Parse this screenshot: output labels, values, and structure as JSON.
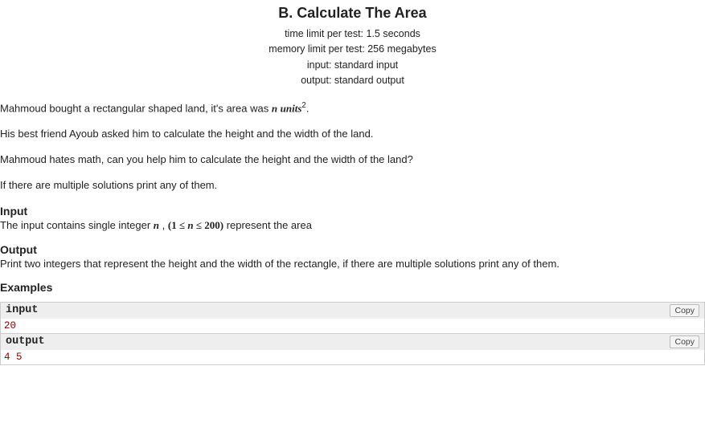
{
  "header": {
    "title": "B. Calculate The Area",
    "time_label": "time limit per test",
    "time_value": "1.5 seconds",
    "memory_label": "memory limit per test",
    "memory_value": "256 megabytes",
    "input_label": "input",
    "input_value": "standard input",
    "output_label": "output",
    "output_value": "standard output"
  },
  "statement": {
    "p1_a": "Mahmoud bought a rectangular shaped land, it's area was ",
    "p1_var": "n",
    "p1_unit": "units",
    "p1_sup": "2",
    "p1_end": ".",
    "p2": "His best friend Ayoub asked him to calculate the height and the width of the land.",
    "p3": "Mahmoud hates math, can you help him to calculate the height and the width of the land?",
    "p4": "If there are multiple solutions print any of them."
  },
  "input_section": {
    "title": "Input",
    "text_a": "The input contains single integer ",
    "var": "n",
    "comma": " , ",
    "c_open": "(",
    "c_low": "1",
    "c_le1": " ≤ ",
    "c_var": "n",
    "c_le2": " ≤ ",
    "c_high": "200",
    "c_close": ")",
    "text_b": " represent the area"
  },
  "output_section": {
    "title": "Output",
    "text": "Print two integers that represent the height and the width of the rectangle, if there are multiple solutions print any of them."
  },
  "examples": {
    "title": "Examples",
    "input_label": "input",
    "output_label": "output",
    "copy_label": "Copy",
    "input_data": "20",
    "output_data": "4 5"
  }
}
